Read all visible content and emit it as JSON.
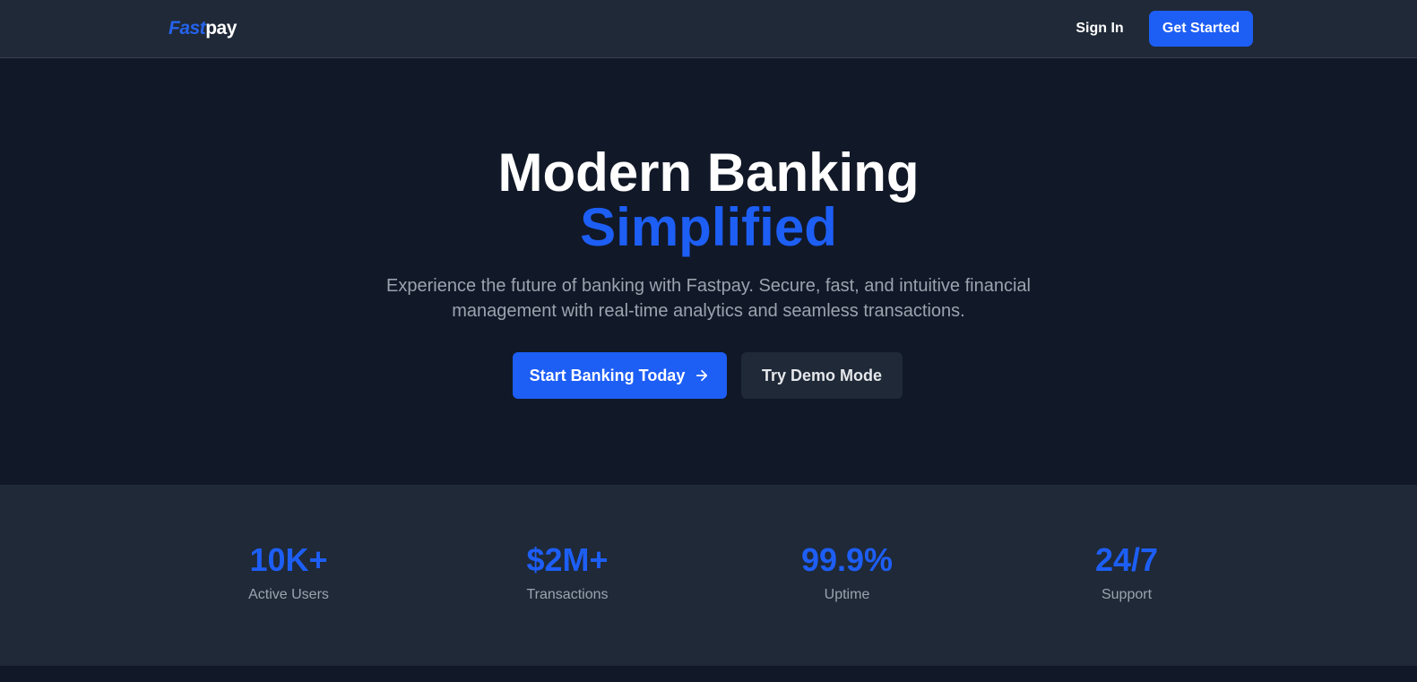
{
  "navbar": {
    "logo_fast": "Fast",
    "logo_pay": "pay",
    "sign_in": "Sign In",
    "get_started": "Get Started"
  },
  "hero": {
    "title": "Modern Banking",
    "accent": "Simplified",
    "subtitle": "Experience the future of banking with Fastpay. Secure, fast, and intuitive financial management with real-time analytics and seamless transactions.",
    "primary_button": "Start Banking Today",
    "secondary_button": "Try Demo Mode",
    "primary_icon": "arrow-right-icon"
  },
  "stats": [
    {
      "value": "10K+",
      "label": "Active Users"
    },
    {
      "value": "$2M+",
      "label": "Transactions"
    },
    {
      "value": "99.9%",
      "label": "Uptime"
    },
    {
      "value": "24/7",
      "label": "Support"
    }
  ],
  "colors": {
    "accent": "#1d5ef5",
    "background": "#111827",
    "surface": "#1f2937",
    "muted_text": "#9ca3af"
  }
}
